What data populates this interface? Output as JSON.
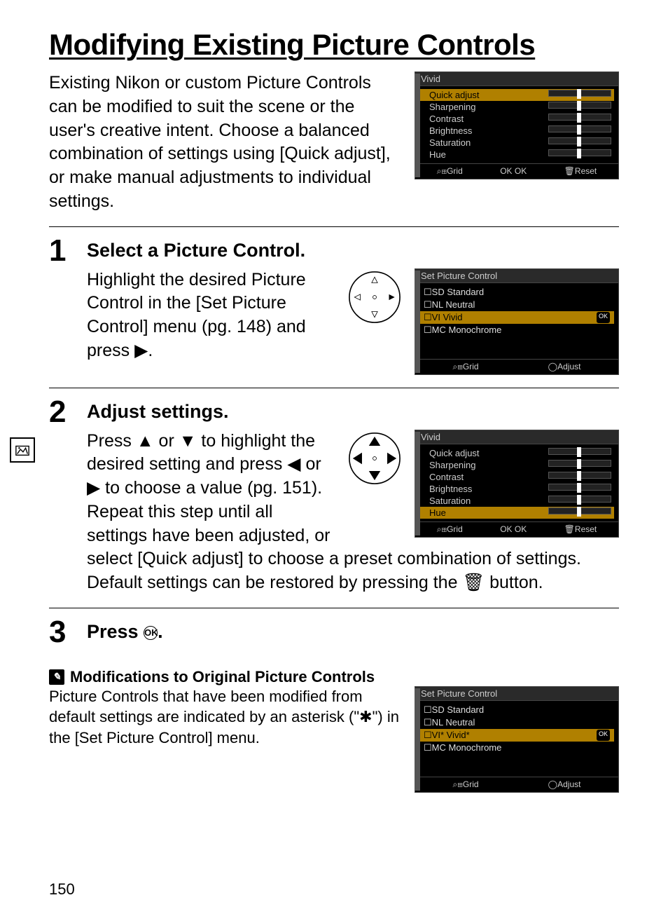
{
  "page_title": "Modifying Existing Picture Controls",
  "intro": "Existing Nikon or custom Picture Controls can be modified to suit the scene or the user's creative intent.  Choose a balanced combination of settings using [Quick adjust], or make manual adjustments to individual settings.",
  "lcd_intro": {
    "title": "Vivid",
    "rows": [
      {
        "label": "Quick adjust"
      },
      {
        "label": "Sharpening"
      },
      {
        "label": "Contrast"
      },
      {
        "label": "Brightness"
      },
      {
        "label": "Saturation"
      },
      {
        "label": "Hue"
      }
    ],
    "foot": [
      "⌕⊞Grid",
      "OK OK",
      "🗑Reset"
    ]
  },
  "step1": {
    "num": "1",
    "head": "Select a Picture Control.",
    "body_prefix": "Highlight the desired Picture Control in the [Set Picture Control] menu (pg. 148) and press ",
    "body_suffix": "."
  },
  "lcd1": {
    "title": "Set Picture Control",
    "items": [
      {
        "code": "SD",
        "label": "Standard"
      },
      {
        "code": "NL",
        "label": "Neutral"
      },
      {
        "code": "VI",
        "label": "Vivid",
        "selected": true
      },
      {
        "code": "MC",
        "label": "Monochrome"
      }
    ],
    "foot": [
      "⌕⊞Grid",
      "◯Adjust"
    ]
  },
  "step2": {
    "num": "2",
    "head": "Adjust settings.",
    "body_line1_prefix": "Press ",
    "body_line1_mid": " or ",
    "body_line1_after": " to highlight the desired setting and press ",
    "body_line1_or": " or ",
    "body_line1_end": " to choose a value (pg. 151). Repeat this step until all settings have been adjusted, or",
    "after": "select [Quick adjust] to choose a preset combination of settings.  Default settings can be restored by pressing the ",
    "after_suffix": " button."
  },
  "lcd2": {
    "title": "Vivid",
    "rows": [
      {
        "label": "Quick adjust"
      },
      {
        "label": "Sharpening"
      },
      {
        "label": "Contrast"
      },
      {
        "label": "Brightness"
      },
      {
        "label": "Saturation"
      },
      {
        "label": "Hue",
        "selected": true
      }
    ],
    "foot": [
      "⌕⊞Grid",
      "OK OK",
      "🗑Reset"
    ]
  },
  "step3": {
    "num": "3",
    "head_prefix": "Press ",
    "head_suffix": "."
  },
  "note": {
    "head": "Modifications to Original Picture Controls",
    "body_prefix": "Picture Controls that have been modified from default settings are indicated by an asterisk (\"",
    "body_suffix": "\") in the [Set Picture Control] menu."
  },
  "lcd_note": {
    "title": "Set Picture Control",
    "items": [
      {
        "code": "SD",
        "label": "Standard"
      },
      {
        "code": "NL",
        "label": "Neutral"
      },
      {
        "code": "VI*",
        "label": "Vivid*",
        "selected": true
      },
      {
        "code": "MC",
        "label": "Monochrome"
      }
    ],
    "foot": [
      "⌕⊞Grid",
      "◯Adjust"
    ]
  },
  "page_number": "150"
}
